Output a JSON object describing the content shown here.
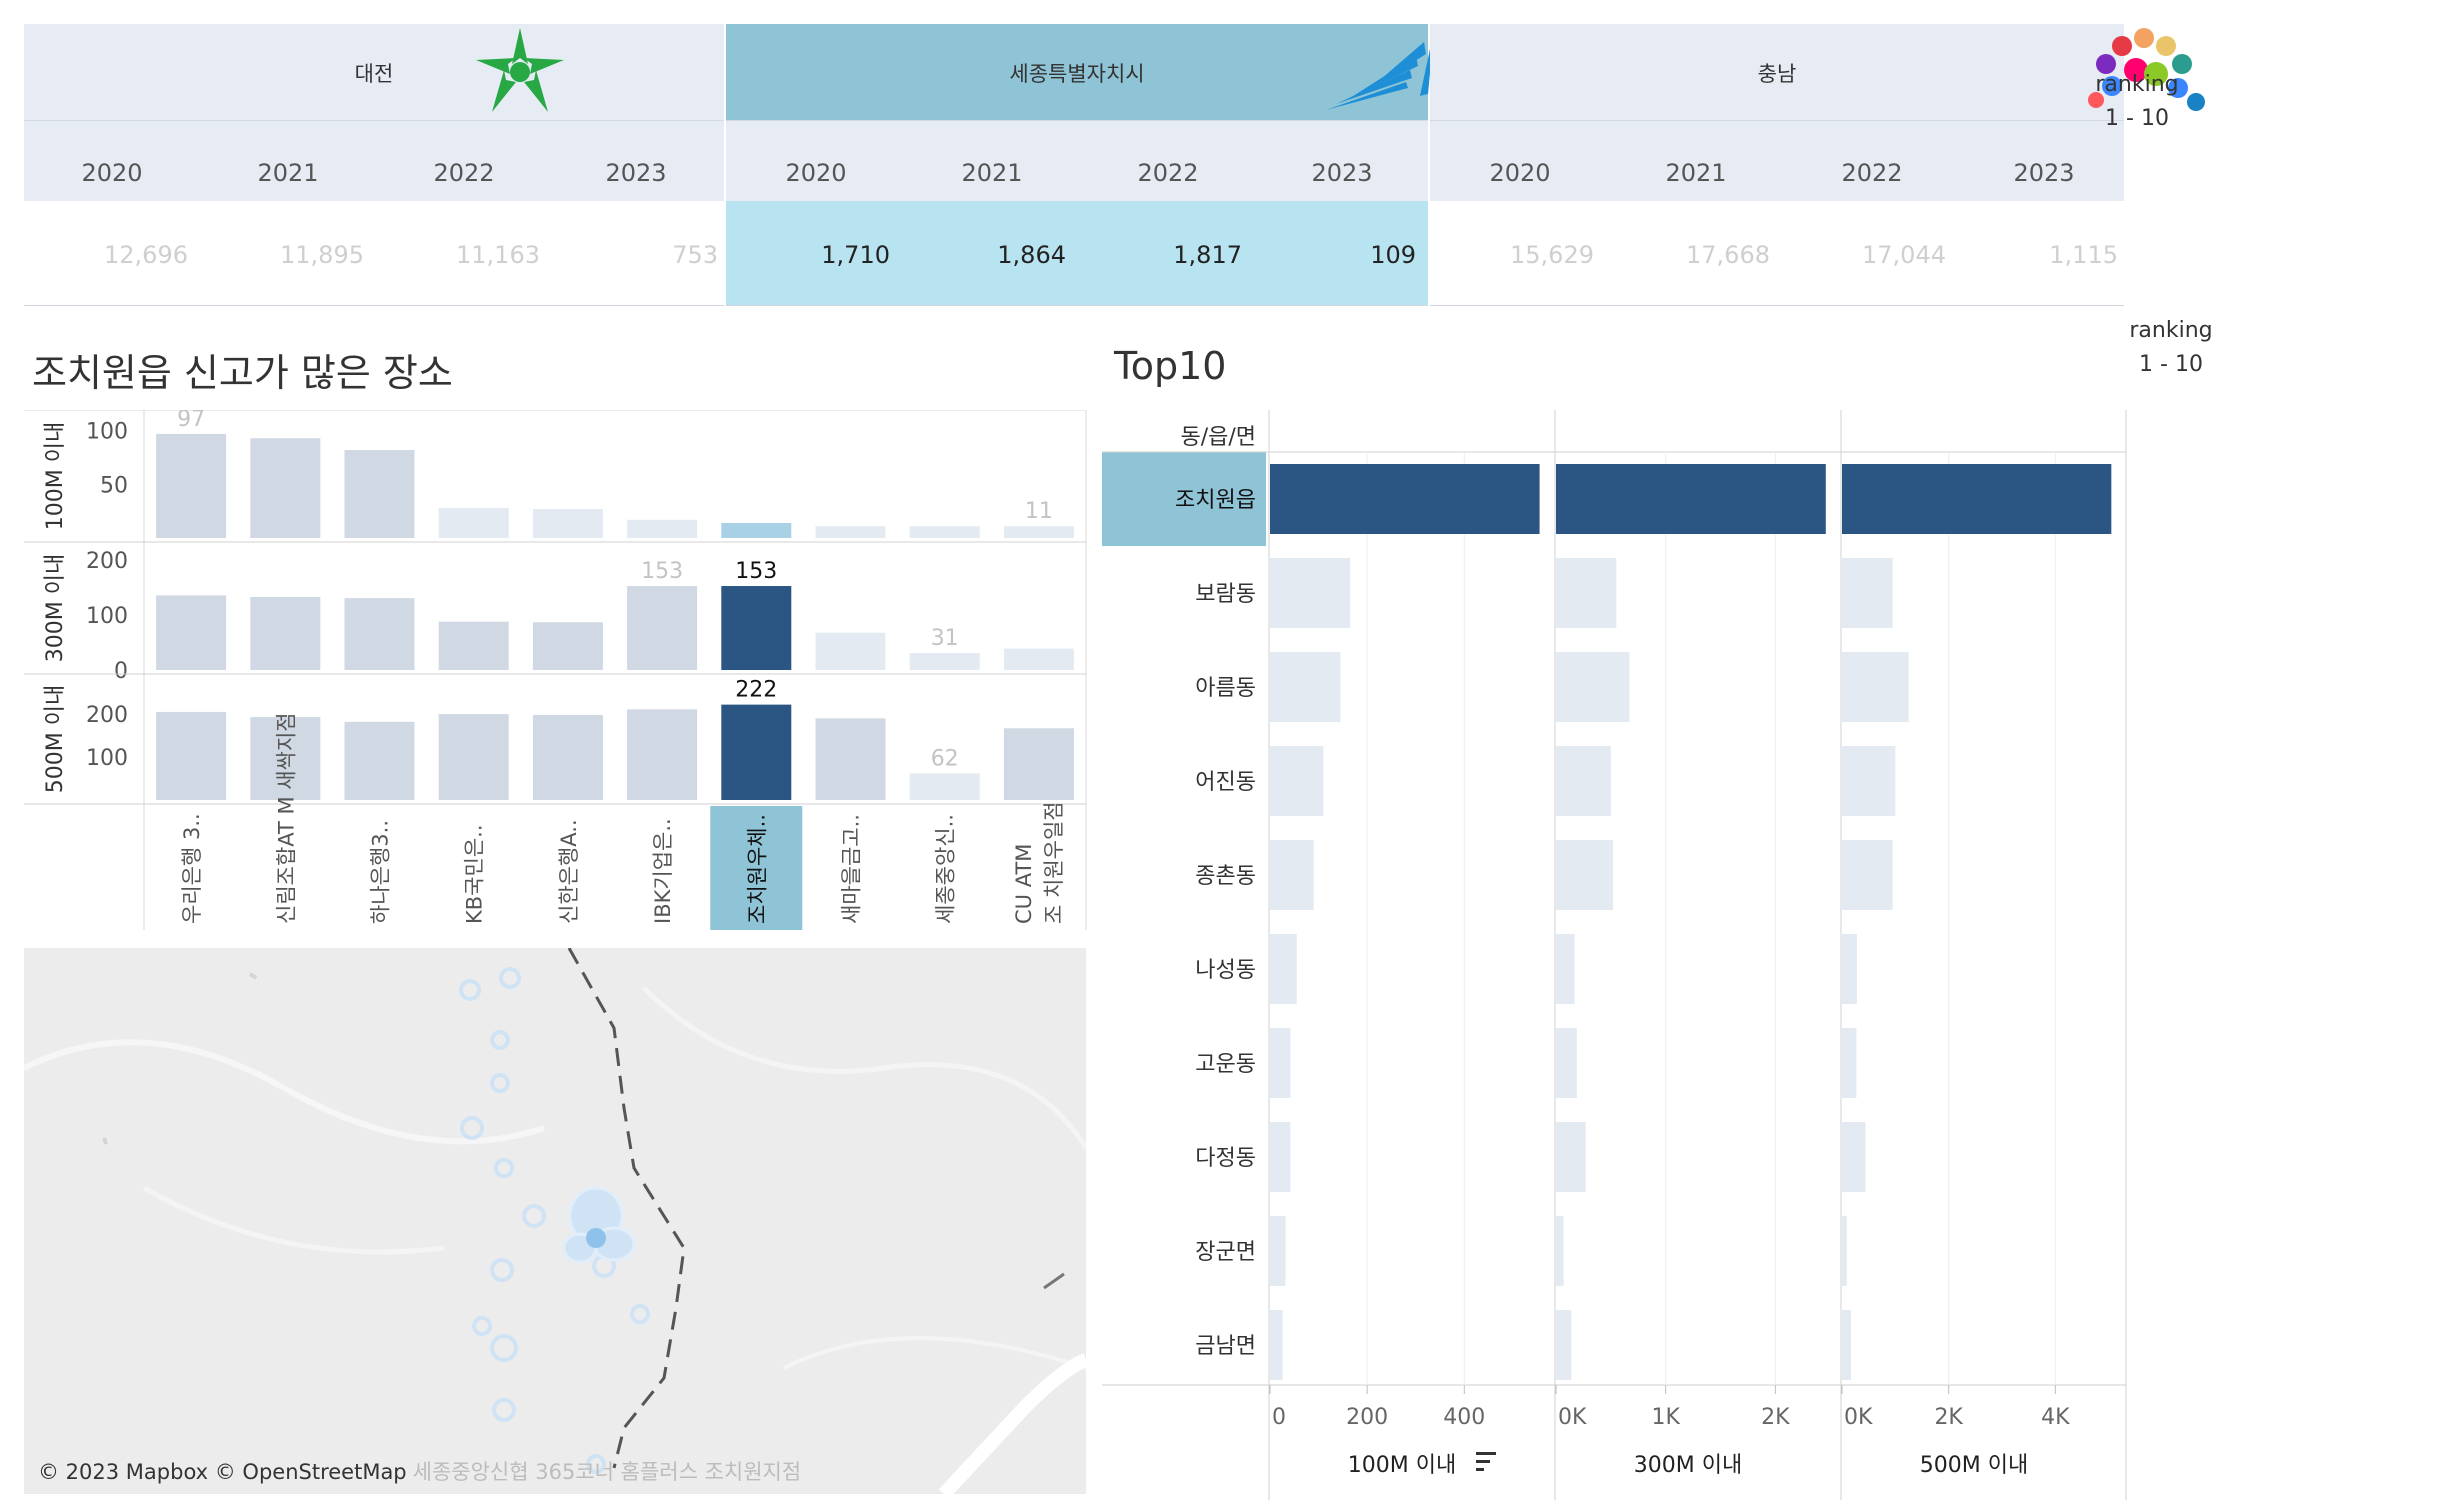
{
  "regions": [
    {
      "name": "대전",
      "logo": "daejeon-logo",
      "active": false,
      "years": [
        "2020",
        "2021",
        "2022",
        "2023"
      ],
      "values": [
        "12,696",
        "11,895",
        "11,163",
        "753"
      ]
    },
    {
      "name": "세종특별자치시",
      "logo": "sejong-logo",
      "active": true,
      "years": [
        "2020",
        "2021",
        "2022",
        "2023"
      ],
      "values": [
        "1,710",
        "1,864",
        "1,817",
        "109"
      ]
    },
    {
      "name": "충남",
      "logo": "chungnam-logo",
      "active": false,
      "years": [
        "2020",
        "2021",
        "2022",
        "2023"
      ],
      "values": [
        "15,629",
        "17,668",
        "17,044",
        "1,115"
      ]
    }
  ],
  "ranking_overlay": {
    "label": "ranking",
    "value": "1 - 10"
  },
  "ranking_filter": {
    "label": "ranking",
    "value": "1 - 10"
  },
  "left_section": {
    "title": "조치원읍 신고가 많은 장소"
  },
  "top10_section": {
    "title": "Top10"
  },
  "colors": {
    "highlight": "#2b5683",
    "bar_mid": "#cfd8e3",
    "bar_faint": "#e3eaf1",
    "selected_bg": "#8fc4d6",
    "selected_bar": "#a9d1e6",
    "header_bg": "#e7ecf4",
    "active_value_bg": "#b8e3f1"
  },
  "chart_data": [
    {
      "type": "bar",
      "title": "조치원읍 신고가 많은 장소",
      "categories": [
        "우리은행 3..",
        "신림조합AT M 새싹지점",
        "하나은행3..",
        "KB국민은..",
        "신한은행A..",
        "IBK기업은..",
        "조치원우체..",
        "새마을금고..",
        "세종중앙신..",
        "CU ATM 조 치원우일점"
      ],
      "selected_category": "조치원우체..",
      "series": [
        {
          "name": "100M 이내",
          "values": [
            97,
            93,
            82,
            28,
            27,
            17,
            14,
            11,
            11,
            11
          ],
          "ylim": [
            0,
            110
          ],
          "ticks": [
            "100",
            "50"
          ],
          "labels": {
            "0": "97",
            "9": "11"
          }
        },
        {
          "name": "300M 이내",
          "values": [
            136,
            133,
            131,
            88,
            87,
            153,
            153,
            68,
            31,
            39
          ],
          "ylim": [
            0,
            215
          ],
          "ticks": [
            "200",
            "100",
            "0"
          ],
          "labels": {
            "5": "153",
            "6": "153",
            "8": "31"
          }
        },
        {
          "name": "500M 이내",
          "values": [
            205,
            193,
            182,
            200,
            198,
            211,
            222,
            190,
            62,
            167
          ],
          "ylim": [
            0,
            270
          ],
          "ticks": [
            "200",
            "100"
          ],
          "labels": {
            "6": "222",
            "8": "62"
          }
        }
      ]
    },
    {
      "type": "bar",
      "title": "Top10",
      "row_header": "동/읍/면",
      "categories": [
        "조치원읍",
        "보람동",
        "아름동",
        "어진동",
        "종촌동",
        "나성동",
        "고운동",
        "다정동",
        "장군면",
        "금남면"
      ],
      "selected_category": "조치원읍",
      "series": [
        {
          "name": "100M 이내",
          "values": [
            555,
            165,
            145,
            110,
            90,
            55,
            42,
            42,
            32,
            26
          ],
          "xlim": [
            0,
            560
          ],
          "ticks": [
            {
              "v": 0,
              "label": "0"
            },
            {
              "v": 200,
              "label": "200"
            },
            {
              "v": 400,
              "label": "400"
            }
          ]
        },
        {
          "name": "300M 이내",
          "values": [
            2460,
            550,
            670,
            500,
            520,
            170,
            190,
            270,
            70,
            140
          ],
          "xlim": [
            0,
            2480
          ],
          "ticks": [
            {
              "v": 0,
              "label": "0K"
            },
            {
              "v": 1000,
              "label": "1K"
            },
            {
              "v": 2000,
              "label": "2K"
            }
          ]
        },
        {
          "name": "500M 이내",
          "values": [
            5050,
            950,
            1250,
            1000,
            950,
            280,
            270,
            440,
            90,
            170
          ],
          "xlim": [
            0,
            5100
          ],
          "ticks": [
            {
              "v": 0,
              "label": "0K"
            },
            {
              "v": 2000,
              "label": "2K"
            },
            {
              "v": 4000,
              "label": "4K"
            }
          ]
        }
      ]
    }
  ],
  "map": {
    "attribution": "© 2023 Mapbox © OpenStreetMap",
    "faint_label": "세종중앙신협 365코너 홈플러스 조치원지점"
  },
  "icons": {
    "sort": "sort-icon"
  }
}
